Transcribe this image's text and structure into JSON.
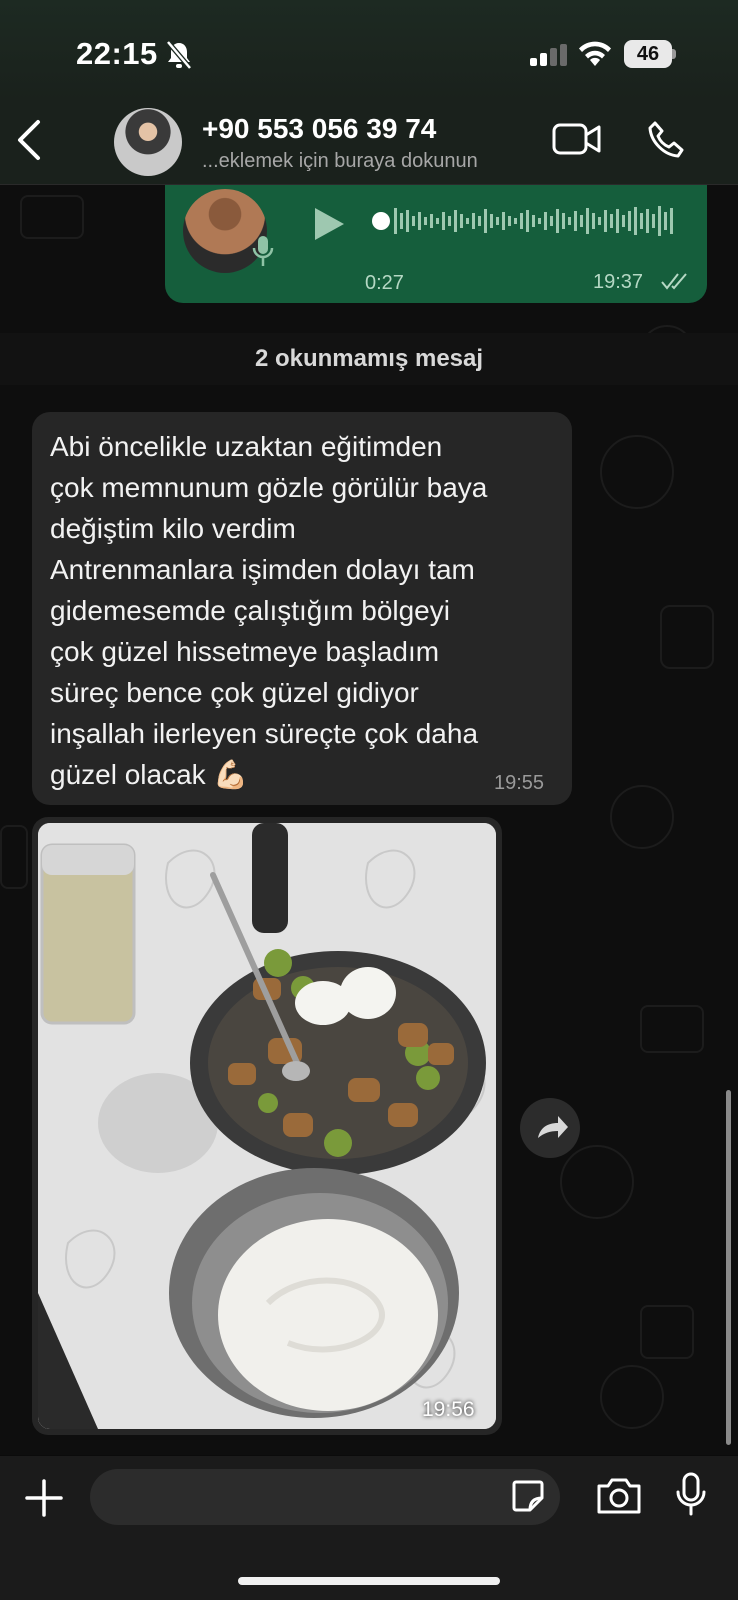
{
  "status_bar": {
    "time": "22:15",
    "battery": "46",
    "icons": [
      "bell-slash-icon",
      "signal-icon",
      "wifi-icon",
      "battery-icon"
    ]
  },
  "header": {
    "contact_name": "+90 553 056 39 74",
    "contact_subtitle": "...eklemek için buraya dokunun",
    "icons": [
      "back-chevron-icon",
      "video-camera-icon",
      "phone-icon"
    ]
  },
  "voice_message": {
    "duration": "0:27",
    "time": "19:37",
    "status": "read"
  },
  "unread_divider": "2 okunmamış mesaj",
  "text_message": {
    "text": "Abi öncelikle uzaktan eğitimden\nçok memnunum gözle görülür baya\ndeğiştim kilo verdim\nAntrenmanlara işimden dolayı tam\ngidemesemde çalıştığım bölgeyi\nçok güzel hissetmeye başladım\nsüreç bence çok güzel gidiyor\ninşallah ilerleyen süreçte çok daha\ngüzel olacak 💪🏻",
    "time": "19:55"
  },
  "image_message": {
    "time": "19:56"
  },
  "composer": {
    "placeholder": "",
    "icons": [
      "plus-icon",
      "sticker-icon",
      "camera-icon",
      "microphone-icon"
    ]
  },
  "colors": {
    "outgoing_bubble": "#155e3c",
    "incoming_bubble": "#262626",
    "background": "#0e0e0e"
  }
}
